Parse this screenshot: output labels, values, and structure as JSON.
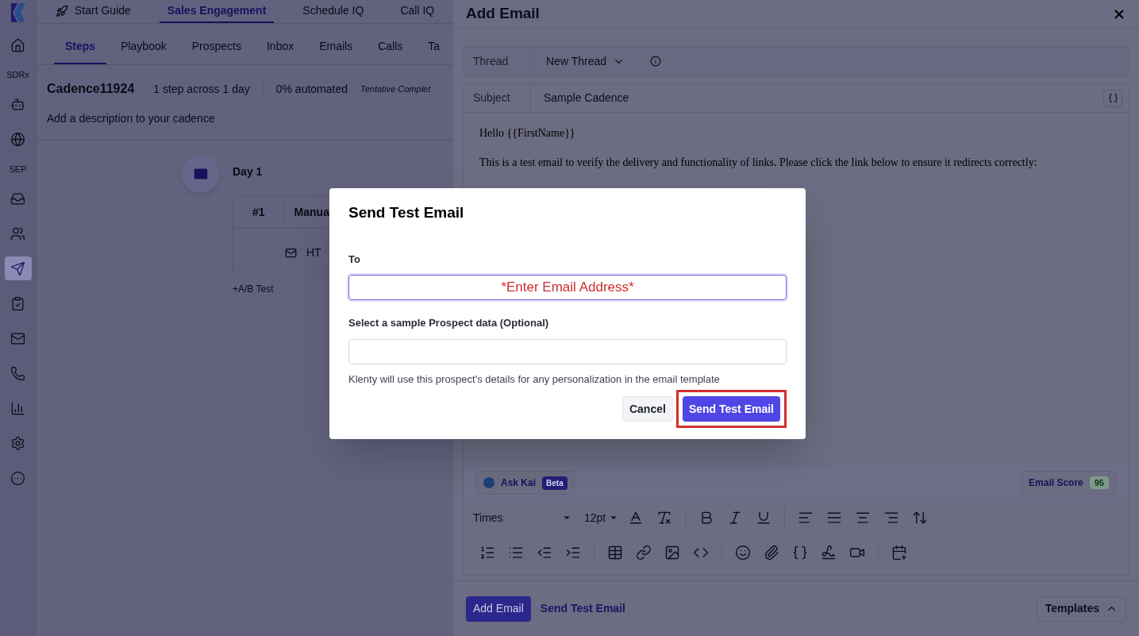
{
  "sidebar": {
    "items": [
      {
        "kind": "logo"
      },
      {
        "kind": "icon",
        "selected": false
      },
      {
        "kind": "label",
        "label": "SDRx"
      },
      {
        "kind": "icon",
        "selected": false
      },
      {
        "kind": "icon",
        "selected": false
      },
      {
        "kind": "label",
        "label": "SEP"
      },
      {
        "kind": "icon",
        "selected": false
      },
      {
        "kind": "icon",
        "selected": false
      },
      {
        "kind": "icon",
        "selected": true
      },
      {
        "kind": "icon",
        "selected": false
      },
      {
        "kind": "icon",
        "selected": false
      },
      {
        "kind": "icon",
        "selected": false
      },
      {
        "kind": "icon",
        "selected": false
      },
      {
        "kind": "icon",
        "selected": false
      },
      {
        "kind": "icon",
        "selected": false
      }
    ]
  },
  "top_nav": [
    {
      "label": "Start Guide",
      "selected": false
    },
    {
      "label": "Sales Engagement",
      "selected": true
    },
    {
      "label": "Schedule IQ",
      "selected": false
    },
    {
      "label": "Call IQ",
      "selected": false
    }
  ],
  "sub_tabs": [
    {
      "label": "Steps",
      "selected": true
    },
    {
      "label": "Playbook",
      "selected": false
    },
    {
      "label": "Prospects",
      "selected": false
    },
    {
      "label": "Inbox",
      "selected": false
    },
    {
      "label": "Emails",
      "selected": false
    },
    {
      "label": "Calls",
      "selected": false
    },
    {
      "label": "Ta",
      "selected": false
    }
  ],
  "cadence": {
    "name": "Cadence11924",
    "steps_summary": "1 step across 1 day",
    "automated": "0% automated",
    "completion": "Tentative Complet",
    "description_placeholder": "Add a description to your cadence"
  },
  "step": {
    "day": "Day 1",
    "number": "#1",
    "type": "Manua",
    "email_name": "HT",
    "ab_test": "+A/B Test"
  },
  "drawer": {
    "title": "Add Email",
    "thread_label": "Thread",
    "thread_value": "New Thread",
    "subject_label": "Subject",
    "subject_value": "Sample Cadence",
    "body": [
      "Hello {{FirstName}}",
      "This is a test email to verify the delivery and functionality of links. Please click the link below to ensure it redirects correctly:"
    ],
    "ask_kai": "Ask Kai",
    "beta": "Beta",
    "email_score_label": "Email Score",
    "email_score": "95",
    "font": "Times",
    "font_size": "12pt",
    "add_button": "Add Email",
    "test_link": "Send Test Email",
    "templates_button": "Templates"
  },
  "modal": {
    "title": "Send Test Email",
    "to_label": "To",
    "to_placeholder": "*Enter Email Address*",
    "prospect_label": "Select a sample Prospect data (Optional)",
    "help": "Klenty will use this prospect's details for any personalization in the email template",
    "buttons": [
      {
        "label": "Cancel",
        "kind": "secondary",
        "highlighted": false
      },
      {
        "label": "Send Test Email",
        "kind": "primary",
        "highlighted": true
      }
    ]
  }
}
